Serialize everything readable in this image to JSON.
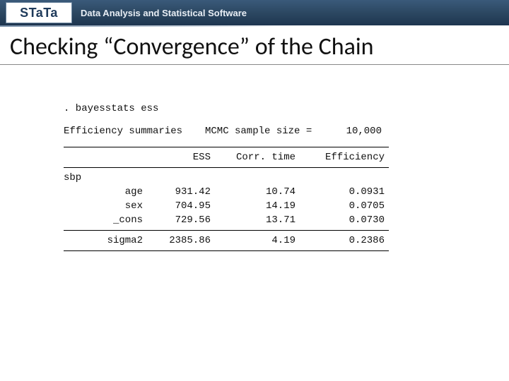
{
  "header": {
    "logo": "STaTa",
    "tagline": "Data Analysis and Statistical Software"
  },
  "title": "Checking “Convergence” of the Chain",
  "output": {
    "command": ". bayesstats ess",
    "summary_label": "Efficiency summaries",
    "sample_label": "MCMC sample size =",
    "sample_value": "10,000",
    "columns": {
      "c1": "ESS",
      "c2": "Corr. time",
      "c3": "Efficiency"
    },
    "group": "sbp",
    "rows": [
      {
        "name": "age",
        "ess": "931.42",
        "corr": "10.74",
        "eff": "0.0931"
      },
      {
        "name": "sex",
        "ess": "704.95",
        "corr": "14.19",
        "eff": "0.0705"
      },
      {
        "name": "_cons",
        "ess": "729.56",
        "corr": "13.71",
        "eff": "0.0730"
      }
    ],
    "sigma": {
      "name": "sigma2",
      "ess": "2385.86",
      "corr": "4.19",
      "eff": "0.2386"
    }
  }
}
